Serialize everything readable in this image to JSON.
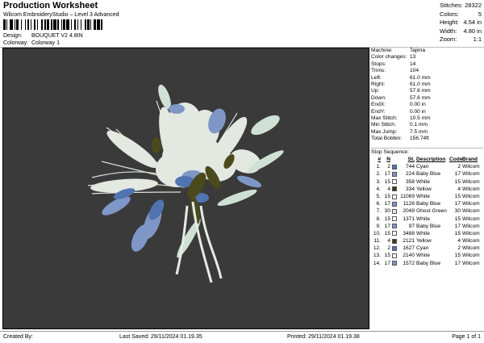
{
  "header": {
    "title": "Production Worksheet",
    "subtitle": "Wilcom EmbroideryStudio – Level 3 Advanced",
    "design_label": "Design:",
    "design_value": "BOUQUET V2 4.8IN",
    "colorway_label": "Colorway:",
    "colorway_value": "Colorway 1"
  },
  "stats": [
    {
      "k": "Stitches:",
      "v": "28322"
    },
    {
      "k": "Colors:",
      "v": "5"
    },
    {
      "k": "Height:",
      "v": "4.54 in"
    },
    {
      "k": "Width:",
      "v": "4.80 in"
    },
    {
      "k": "Zoom:",
      "v": "1:1"
    }
  ],
  "info": [
    {
      "k": "Machine:",
      "v": "Tajima"
    },
    {
      "k": "Color changes:",
      "v": "13"
    },
    {
      "k": "Stops:",
      "v": "14"
    },
    {
      "k": "Trims:",
      "v": "104"
    },
    {
      "k": "Left:",
      "v": "61.0 mm"
    },
    {
      "k": "Right:",
      "v": "61.0 mm"
    },
    {
      "k": "Up:",
      "v": "57.6 mm"
    },
    {
      "k": "Down:",
      "v": "57.6 mm"
    },
    {
      "k": "EndX:",
      "v": "0.00 in"
    },
    {
      "k": "EndY:",
      "v": "0.00 in"
    },
    {
      "k": "Max Stitch:",
      "v": "10.5 mm"
    },
    {
      "k": "Min Stitch:",
      "v": "0.1 mm"
    },
    {
      "k": "Max Jump:",
      "v": "7.5 mm"
    },
    {
      "k": "Total Bobbin:",
      "v": "156.74ft"
    }
  ],
  "stop_sequence": {
    "title": "Stop Sequence:",
    "headers": {
      "n": "#",
      "n2": "N",
      "st": "St.",
      "desc": "Description",
      "code": "Code",
      "brand": "Brand"
    },
    "rows": [
      {
        "n": "1.",
        "cn": "2",
        "color": "#4f74b0",
        "st": "744",
        "desc": "Cyan",
        "code": "2",
        "brand": "Wilcom"
      },
      {
        "n": "2.",
        "cn": "17",
        "color": "#7f97c6",
        "st": "224",
        "desc": "Baby Blue",
        "code": "17",
        "brand": "Wilcom"
      },
      {
        "n": "3.",
        "cn": "15",
        "color": "#ffffff",
        "st": "358",
        "desc": "White",
        "code": "15",
        "brand": "Wilcom"
      },
      {
        "n": "4.",
        "cn": "4",
        "color": "#3a3b12",
        "st": "334",
        "desc": "Yellow",
        "code": "4",
        "brand": "Wilcom"
      },
      {
        "n": "5.",
        "cn": "15",
        "color": "#ffffff",
        "st": "11069",
        "desc": "White",
        "code": "15",
        "brand": "Wilcom"
      },
      {
        "n": "6.",
        "cn": "17",
        "color": "#7f97c6",
        "st": "1126",
        "desc": "Baby Blue",
        "code": "17",
        "brand": "Wilcom"
      },
      {
        "n": "7.",
        "cn": "30",
        "color": "#dfe9e0",
        "st": "2049",
        "desc": "Ghost Green",
        "code": "30",
        "brand": "Wilcom"
      },
      {
        "n": "8.",
        "cn": "15",
        "color": "#ffffff",
        "st": "1371",
        "desc": "White",
        "code": "15",
        "brand": "Wilcom"
      },
      {
        "n": "9.",
        "cn": "17",
        "color": "#7f97c6",
        "st": "97",
        "desc": "Baby Blue",
        "code": "17",
        "brand": "Wilcom"
      },
      {
        "n": "10.",
        "cn": "15",
        "color": "#ffffff",
        "st": "3488",
        "desc": "White",
        "code": "15",
        "brand": "Wilcom"
      },
      {
        "n": "11.",
        "cn": "4",
        "color": "#3a3b12",
        "st": "2121",
        "desc": "Yellow",
        "code": "4",
        "brand": "Wilcom"
      },
      {
        "n": "12.",
        "cn": "2",
        "color": "#4f74b0",
        "st": "1627",
        "desc": "Cyan",
        "code": "2",
        "brand": "Wilcom"
      },
      {
        "n": "13.",
        "cn": "15",
        "color": "#ffffff",
        "st": "2140",
        "desc": "White",
        "code": "15",
        "brand": "Wilcom"
      },
      {
        "n": "14.",
        "cn": "17",
        "color": "#7f97c6",
        "st": "1572",
        "desc": "Baby Blue",
        "code": "17",
        "brand": "Wilcom"
      }
    ]
  },
  "footer": {
    "created_by": "Created By:",
    "last_saved": "Last Saved: 29/11/2024 01.19.35",
    "printed": "Printed: 29/11/2024 01.19.38",
    "page": "Page 1 of 1"
  },
  "colors": {
    "canvas_bg": "#3a3a3a",
    "thread_white": "#e8ece6",
    "thread_baby_blue": "#7f97c6",
    "thread_cyan": "#4f74b0",
    "thread_yellow": "#4b4a1c",
    "thread_ghost_green": "#cfe0d4"
  }
}
